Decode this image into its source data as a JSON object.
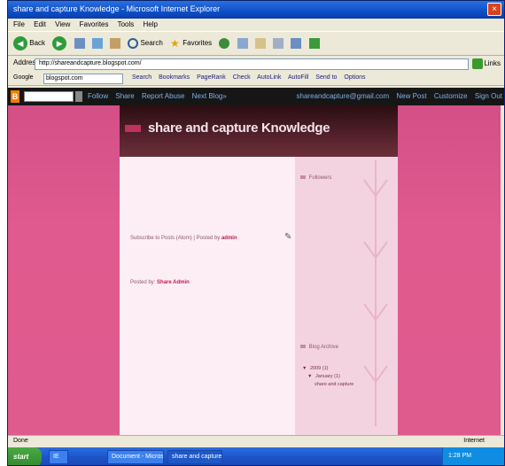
{
  "window": {
    "title": "share and capture Knowledge - Microsoft Internet Explorer",
    "close_glyph": "×"
  },
  "menu": [
    "File",
    "Edit",
    "View",
    "Favorites",
    "Tools",
    "Help"
  ],
  "toolbar": {
    "back_label": "Back",
    "search_label": "Search",
    "favorites_label": "Favorites"
  },
  "address": {
    "label": "Address",
    "url": "http://shareandcapture.blogspot.com/",
    "links_label": "Links"
  },
  "google_bar": {
    "label": "Google",
    "value": "blogspot.com",
    "links": [
      "Search",
      "Bookmarks",
      "PageRank",
      "Check",
      "AutoLink",
      "AutoFill",
      "Send to",
      "Options"
    ]
  },
  "blogger_nav": {
    "logo_glyph": "B",
    "links": [
      "Follow",
      "Share",
      "Report Abuse",
      "Next Blog»"
    ],
    "right_links": [
      "shareandcapture@gmail.com",
      "New Post",
      "Customize",
      "Sign Out"
    ]
  },
  "blog": {
    "title": "share and capture Knowledge"
  },
  "main": {
    "post_text": "Subscribe to Posts (Atom) | Posted by",
    "post_link": "admin",
    "edit_glyph": "✎",
    "posted_by_label": "Posted by:",
    "posted_by_value": "Share Admin"
  },
  "sidebar": {
    "followers_title": "Followers",
    "archive_title": "Blog Archive",
    "archive_items": [
      "2009 (1)",
      "January (1)",
      "share and capture"
    ]
  },
  "status": {
    "left": "Done",
    "right": "Internet"
  },
  "taskbar": {
    "start": "start",
    "items": [
      "IE",
      "Document - Microsoft",
      "share and capture Kn..."
    ],
    "clock": "1:28 PM"
  }
}
